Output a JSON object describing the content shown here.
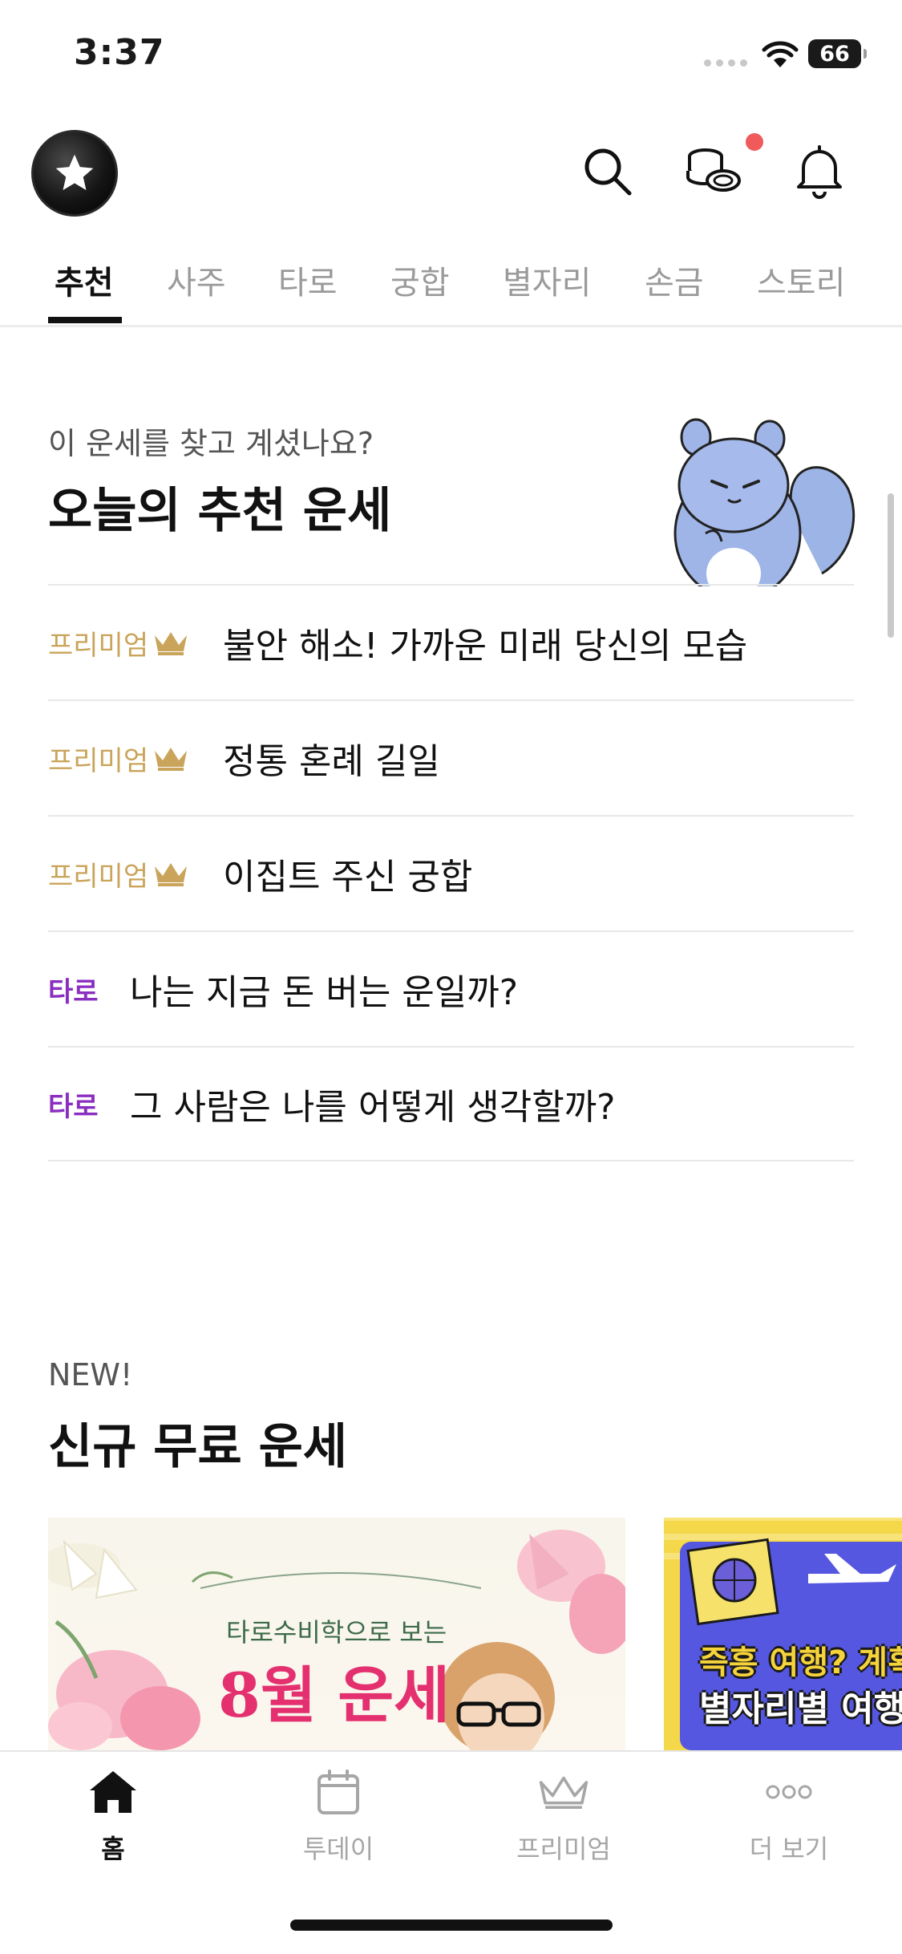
{
  "status_bar": {
    "time": "3:37",
    "battery": "66"
  },
  "header": {
    "logo": "star-logo",
    "has_notification_dot": true
  },
  "tabs": [
    {
      "label": "추천",
      "active": true
    },
    {
      "label": "사주",
      "active": false
    },
    {
      "label": "타로",
      "active": false
    },
    {
      "label": "궁합",
      "active": false
    },
    {
      "label": "별자리",
      "active": false
    },
    {
      "label": "손금",
      "active": false
    },
    {
      "label": "스토리",
      "active": false
    }
  ],
  "recommend": {
    "subtitle": "이 운세를 찾고 계셨나요?",
    "title": "오늘의 추천 운세",
    "items": [
      {
        "badge": "프리미엄",
        "badge_type": "premium",
        "text": "불안 해소! 가까운 미래 당신의 모습"
      },
      {
        "badge": "프리미엄",
        "badge_type": "premium",
        "text": "정통 혼례 길일"
      },
      {
        "badge": "프리미엄",
        "badge_type": "premium",
        "text": "이집트 주신 궁합"
      },
      {
        "badge": "타로",
        "badge_type": "tarot",
        "text": "나는 지금 돈 버는 운일까?"
      },
      {
        "badge": "타로",
        "badge_type": "tarot",
        "text": "그 사람은 나를 어떻게 생각할까?"
      }
    ]
  },
  "new_free": {
    "label": "NEW!",
    "title": "신규 무료 운세",
    "banners": [
      {
        "subtitle": "타로수비학으로 보는",
        "title": "8월 운세"
      },
      {
        "line1": "즉흥 여행? 계획",
        "line2": "별자리별 여행"
      }
    ]
  },
  "bottom_nav": [
    {
      "label": "홈",
      "icon": "home-icon",
      "active": true
    },
    {
      "label": "투데이",
      "icon": "calendar-icon",
      "active": false
    },
    {
      "label": "프리미엄",
      "icon": "crown-icon",
      "active": false
    },
    {
      "label": "더 보기",
      "icon": "more-icon",
      "active": false
    }
  ],
  "colors": {
    "premium": "#c9a45a",
    "tarot": "#8a2ec0",
    "accent_red": "#f05a5a",
    "text": "#111111",
    "muted": "#9a9a9a"
  }
}
